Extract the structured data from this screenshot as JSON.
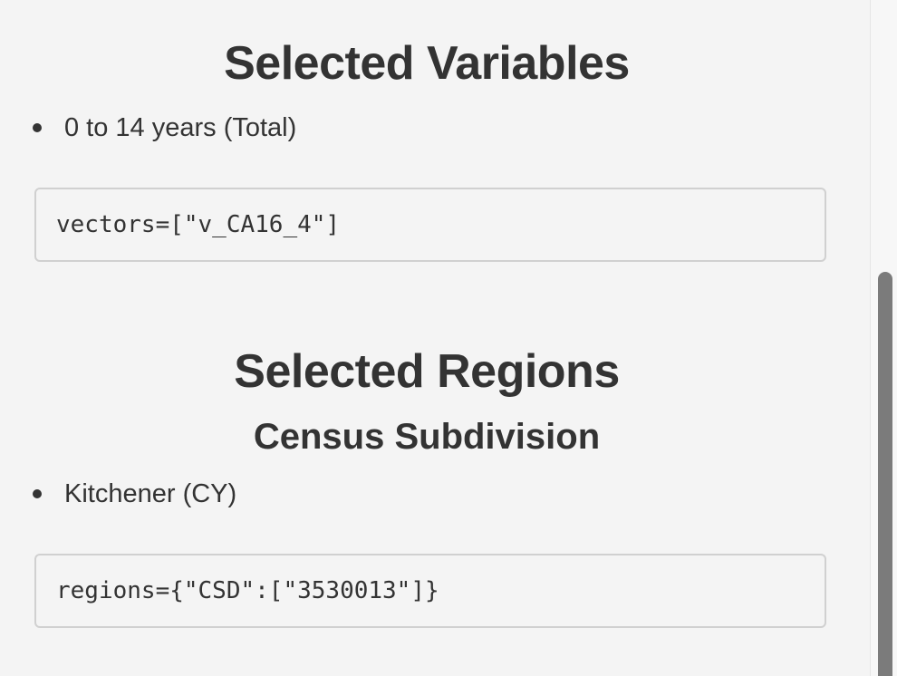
{
  "variables": {
    "title": "Selected Variables",
    "items": [
      "0 to 14 years (Total)"
    ],
    "code": "vectors=[\"v_CA16_4\"]"
  },
  "regions": {
    "title": "Selected Regions",
    "subtitle": "Census Subdivision",
    "items": [
      "Kitchener (CY)"
    ],
    "code": "regions={\"CSD\":[\"3530013\"]}"
  }
}
